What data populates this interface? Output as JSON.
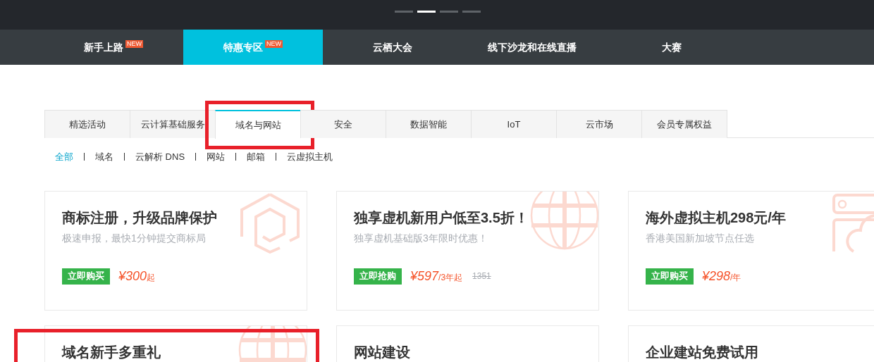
{
  "carousel": {
    "dots": [
      {
        "selected": false
      },
      {
        "selected": true
      },
      {
        "selected": false
      },
      {
        "selected": false
      }
    ]
  },
  "nav": [
    {
      "label": "新手上路",
      "badge": "NEW",
      "selected": false
    },
    {
      "label": "特惠专区",
      "badge": "NEW",
      "selected": true
    },
    {
      "label": "云栖大会",
      "selected": false
    },
    {
      "label": "线下沙龙和在线直播",
      "selected": false
    },
    {
      "label": "大赛",
      "selected": false
    }
  ],
  "tabs": [
    {
      "label": "精选活动",
      "selected": false,
      "highlighted": false
    },
    {
      "label": "云计算基础服务",
      "selected": false,
      "highlighted": false
    },
    {
      "label": "域名与网站",
      "selected": true,
      "highlighted": true
    },
    {
      "label": "安全",
      "selected": false,
      "highlighted": false
    },
    {
      "label": "数据智能",
      "selected": false,
      "highlighted": false
    },
    {
      "label": "IoT",
      "selected": false,
      "highlighted": false
    },
    {
      "label": "云市场",
      "selected": false,
      "highlighted": false
    },
    {
      "label": "会员专属权益",
      "selected": false,
      "highlighted": false
    }
  ],
  "filters": [
    {
      "label": "全部",
      "selected": true
    },
    {
      "label": "域名",
      "selected": false
    },
    {
      "label": "云解析 DNS",
      "selected": false
    },
    {
      "label": "网站",
      "selected": false
    },
    {
      "label": "邮箱",
      "selected": false
    },
    {
      "label": "云虚拟主机",
      "selected": false
    }
  ],
  "cards": [
    {
      "title": "商标注册，升级品牌保护",
      "subtitle": "极速申报，最快1分钟提交商标局",
      "button": "立即购买",
      "price": "¥300",
      "unit": "起",
      "kind": "hexagon",
      "highlighted": false
    },
    {
      "title": "独享虚机新用户低至3.5折！",
      "subtitle": "独享虚机基础版3年限时优惠！",
      "button": "立即抢购",
      "price": "¥597",
      "unit": "/3年起",
      "old_price": "1351",
      "kind": "globe",
      "highlighted": false
    },
    {
      "title": "海外虚拟主机298元/年",
      "subtitle": "香港美国新加坡节点任选",
      "button": "立即购买",
      "price": "¥298",
      "unit": "/年",
      "kind": "server",
      "highlighted": false
    },
    {
      "title": "域名新手多重礼",
      "kind": "globe",
      "highlighted": true
    },
    {
      "title": "网站建设",
      "kind": "plain",
      "highlighted": false
    },
    {
      "title": "企业建站免费试用",
      "kind": "plain",
      "highlighted": false
    }
  ]
}
